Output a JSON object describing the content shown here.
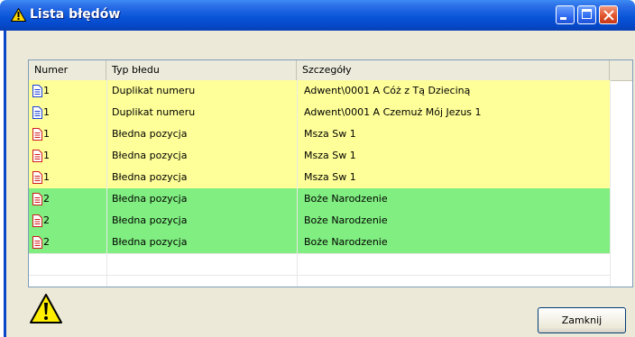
{
  "window": {
    "title": "Lista błędów",
    "title_icon": "warning-icon"
  },
  "columns": [
    "Numer",
    "Typ błedu",
    "Szczegóły"
  ],
  "rows": [
    {
      "icon": "blue-doc-icon",
      "num": "1",
      "type": "Duplikat numeru",
      "details": "Adwent\\0001 A Cóż z Tą Dzieciną",
      "bg": "#ffff99"
    },
    {
      "icon": "blue-doc-icon",
      "num": "1",
      "type": "Duplikat numeru",
      "details": "Adwent\\0001 A Czemuż Mój Jezus 1",
      "bg": "#ffff99"
    },
    {
      "icon": "red-doc-icon",
      "num": "1",
      "type": "Błedna pozycja",
      "details": "Msza Sw 1",
      "bg": "#ffff99"
    },
    {
      "icon": "red-doc-icon",
      "num": "1",
      "type": "Błedna pozycja",
      "details": "Msza Sw 1",
      "bg": "#ffff99"
    },
    {
      "icon": "red-doc-icon",
      "num": "1",
      "type": "Błedna pozycja",
      "details": "Msza Sw 1",
      "bg": "#ffff99"
    },
    {
      "icon": "red-doc-icon",
      "num": "2",
      "type": "Błedna pozycja",
      "details": "Boże Narodzenie",
      "bg": "#80ee80"
    },
    {
      "icon": "red-doc-icon",
      "num": "2",
      "type": "Błedna pozycja",
      "details": "Boże Narodzenie",
      "bg": "#80ee80"
    },
    {
      "icon": "red-doc-icon",
      "num": "2",
      "type": "Błedna pozycja",
      "details": "Boże Narodzenie",
      "bg": "#80ee80"
    }
  ],
  "footer": {
    "close_label": "Zamknij",
    "warning_icon": "warning-icon"
  },
  "colors": {
    "yellow_row": "#ffff99",
    "green_row": "#80ee80",
    "titlebar": "#0a55da"
  }
}
